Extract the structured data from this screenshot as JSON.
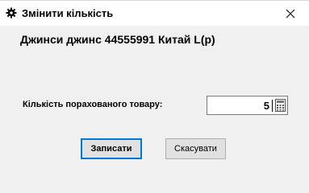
{
  "window": {
    "title": "Змінити кількість"
  },
  "icons": {
    "title": "gear-icon",
    "close": "close-icon",
    "calculator": "calculator-icon"
  },
  "item": {
    "name": "Джинси джинс 44555991 Китай L(р)"
  },
  "quantity": {
    "label": "Кількість порахованого товару:",
    "value": "5"
  },
  "buttons": {
    "save_label": "Записати",
    "cancel_label": "Скасувати"
  },
  "colors": {
    "focus_border": "#0078d7",
    "background": "#f0f0f0",
    "titlebar": "#ffffff"
  }
}
